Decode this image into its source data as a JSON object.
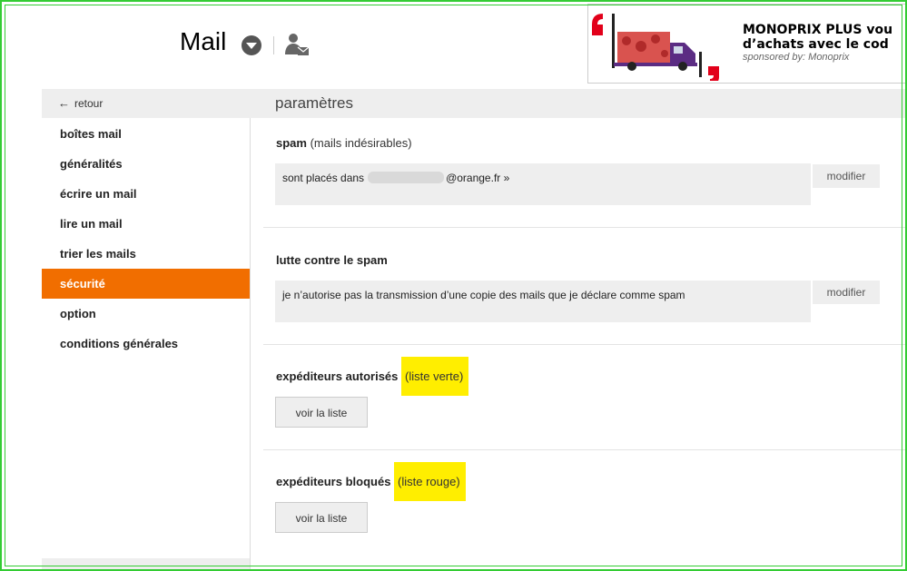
{
  "header": {
    "app_title": "Mail"
  },
  "ad": {
    "headline_line1": "MONOPRIX PLUS vou",
    "headline_line2": "d’achats avec le cod",
    "sponsor": "sponsored by: Monoprix"
  },
  "sidebar": {
    "back_label": "retour",
    "items": [
      {
        "label": "boîtes mail"
      },
      {
        "label": "généralités"
      },
      {
        "label": "écrire un mail"
      },
      {
        "label": "lire un mail"
      },
      {
        "label": "trier les mails"
      },
      {
        "label": "sécurité",
        "active": true
      },
      {
        "label": "option"
      },
      {
        "label": "conditions générales"
      }
    ]
  },
  "main": {
    "title": "paramètres",
    "spam": {
      "title": "spam",
      "note": "(mails indésirables)",
      "value_prefix": "sont placés dans",
      "value_suffix": "@orange.fr »",
      "modify_label": "modifier"
    },
    "anti_spam": {
      "title": "lutte contre le spam",
      "value": "je n’autorise pas la transmission d’une copie des mails que je déclare comme spam",
      "modify_label": "modifier"
    },
    "allowed": {
      "title": "expéditeurs autorisés",
      "note": "(liste verte)",
      "button_label": "voir la liste"
    },
    "blocked": {
      "title": "expéditeurs bloqués",
      "note": "(liste rouge)",
      "button_label": "voir la liste"
    }
  },
  "colors": {
    "accent": "#f16e00",
    "highlight": "#ffee00",
    "frame": "#33cc33"
  }
}
